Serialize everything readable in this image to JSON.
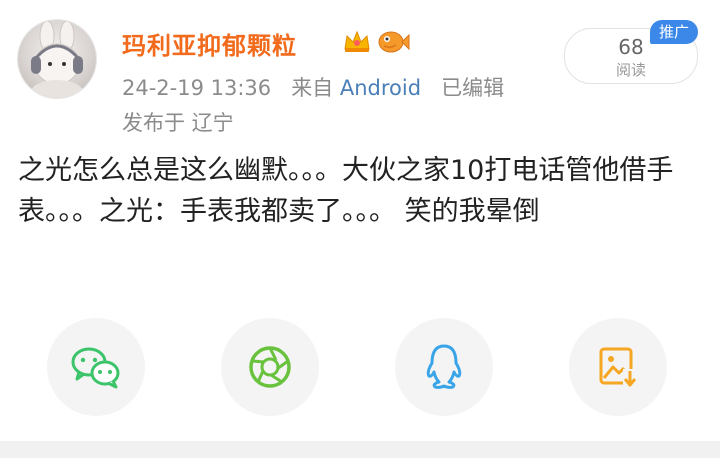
{
  "post": {
    "author": "玛利亚抑郁颗粒",
    "time": "24-2-19 13:36",
    "from_label": "来自",
    "source": "Android",
    "edited": "已编辑",
    "location": "发布于 辽宁",
    "views_count": "68",
    "views_label": "阅读",
    "promo_label": "推广",
    "content": "之光怎么总是这么幽默。。。大伙之家10打电话管他借手表。。。之光：手表我都卖了。。。 笑的我晕倒"
  },
  "share": [
    {
      "icon": "wechat-icon",
      "color": "#3cc46a"
    },
    {
      "icon": "moments-icon",
      "color": "#69c23d"
    },
    {
      "icon": "qq-icon",
      "color": "#3aa4e8"
    },
    {
      "icon": "save-image-icon",
      "color": "#f5a623"
    }
  ],
  "colors": {
    "author": "#f26a1b",
    "source": "#4a7fb7",
    "promo": "#3b88e8"
  }
}
